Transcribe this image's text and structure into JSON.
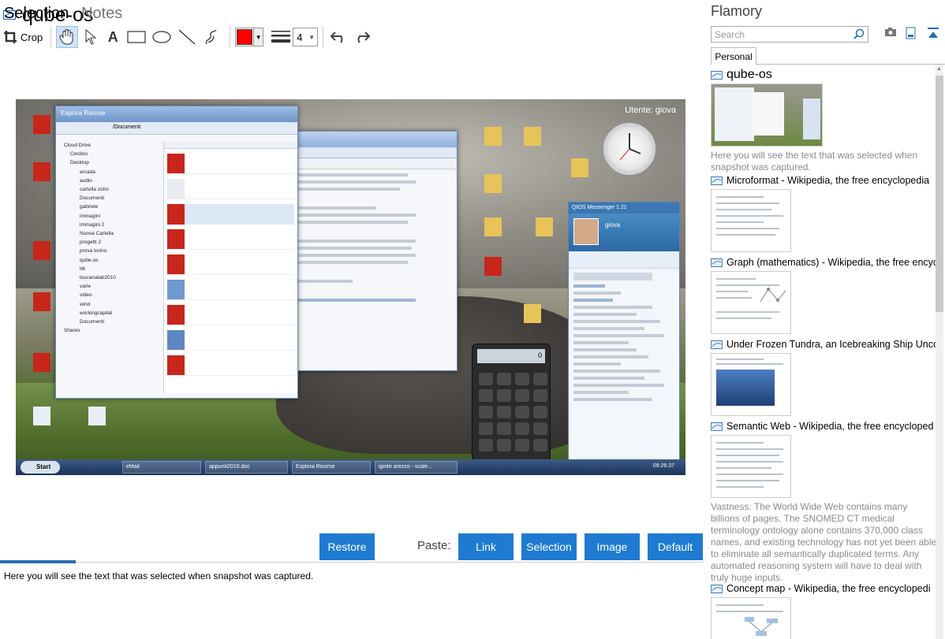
{
  "app": {
    "doc_title": "qube-os"
  },
  "toolbar": {
    "crop_label": "Crop",
    "tools": [
      "hand-icon",
      "arrow-icon",
      "text-icon",
      "rectangle-icon",
      "ellipse-icon",
      "line-icon",
      "freehand-icon"
    ],
    "color": "#ff0000",
    "line_width": "4",
    "undo_icon": "undo-icon",
    "redo_icon": "redo-icon"
  },
  "screenshot": {
    "user_label": "Utente: giova",
    "explorer_title": "Esplora Risorse",
    "explorer_address": "/Documenti",
    "explorer_tree": [
      "Cloud Drive",
      "Cestino",
      "Desktop",
      "arcada",
      "audio",
      "cartella zoho",
      "Documenti",
      "gabriele",
      "immagini",
      "immagini 2",
      "Nuova Cartella",
      "progetti 2",
      "prova torino",
      "qube-os",
      "t4l",
      "toscanalab2010",
      "varie",
      "video",
      "wind",
      "workingcapital",
      "Documenti",
      "Shares"
    ],
    "messenger_title": "QIOS Messenger 1.21",
    "messenger_user": "giova",
    "start_label": "Start",
    "tasks": [
      "eMail",
      "appunti2010.doc",
      "Esplora Risorse",
      "ignite arezzo - scale..."
    ],
    "tray_time": "09:26:37",
    "calc_display": "0"
  },
  "bottom": {
    "tab_selection": "Selection",
    "tab_notes": "Notes",
    "restore_label": "Restore",
    "paste_label": "Paste:",
    "link_label": "Link",
    "selection_label": "Selection",
    "image_label": "Image",
    "default_label": "Default",
    "notes_text": "Here you will see the text that was selected when snapshot was captured."
  },
  "sidebar": {
    "brand": "Flamory",
    "search_placeholder": "Search",
    "tab_personal": "Personal",
    "icons": [
      "camera-icon",
      "page-icon",
      "dock-icon"
    ],
    "items": [
      {
        "title": "qube-os",
        "desc": "Here you will see the text that was selected when snapshot was captured."
      },
      {
        "title": "Microformat - Wikipedia, the free encyclopedia",
        "desc": ""
      },
      {
        "title": "Graph (mathematics) - Wikipedia, the free encyc",
        "desc": ""
      },
      {
        "title": "Under Frozen Tundra, an Icebreaking Ship Unco",
        "desc": ""
      },
      {
        "title": "Semantic Web - Wikipedia, the free encycloped",
        "desc": "Vastness: The World Wide Web contains many billions of pages. The SNOMED CT medical terminology ontology alone contains 370,000 class names, and existing technology has not yet been able to eliminate all semantically duplicated terms. Any automated reasoning system will have to deal with truly huge inputs."
      },
      {
        "title": "Concept map - Wikipedia, the free encyclopedi",
        "desc": ""
      }
    ]
  }
}
